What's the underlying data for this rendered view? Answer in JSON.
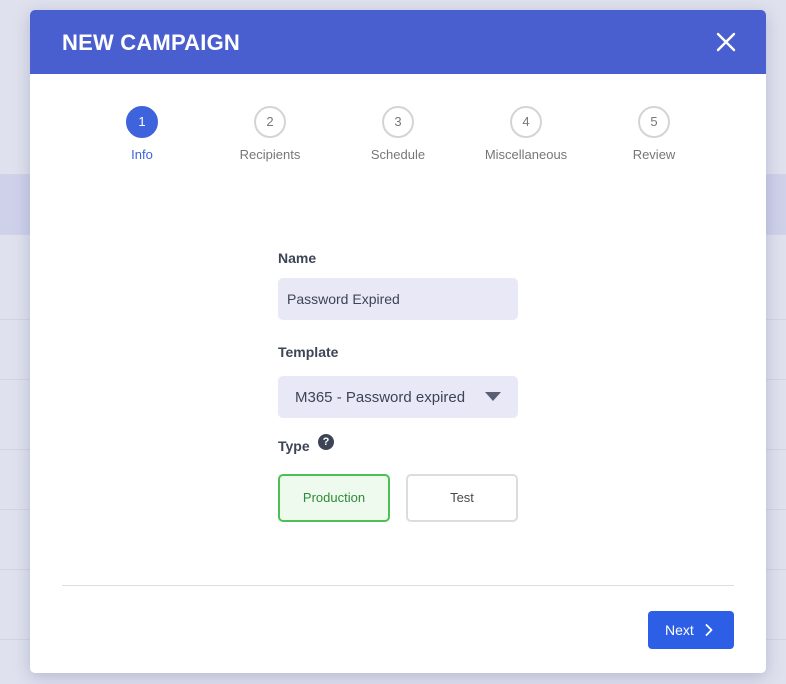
{
  "modal": {
    "title": "NEW CAMPAIGN",
    "accent_color": "#4a5fcf",
    "close_icon": "close-icon"
  },
  "stepper": {
    "active_step": 1,
    "steps": [
      {
        "number": "1",
        "label": "Info"
      },
      {
        "number": "2",
        "label": "Recipients"
      },
      {
        "number": "3",
        "label": "Schedule"
      },
      {
        "number": "4",
        "label": "Miscellaneous"
      },
      {
        "number": "5",
        "label": "Review"
      }
    ]
  },
  "form": {
    "name": {
      "label": "Name",
      "value": "Password Expired"
    },
    "template": {
      "label": "Template",
      "selected": "M365 - Password expired",
      "caret_icon": "caret-down-icon"
    },
    "type": {
      "label": "Type",
      "help_icon": "help-icon",
      "help_glyph": "?",
      "options": [
        {
          "label": "Production",
          "selected": true
        },
        {
          "label": "Test",
          "selected": false
        }
      ]
    }
  },
  "footer": {
    "next_label": "Next",
    "next_icon": "chevron-right-icon",
    "button_color": "#2d5fe6"
  },
  "colors": {
    "selected_green": "#4cc052",
    "active_blue": "#3f63dd"
  }
}
